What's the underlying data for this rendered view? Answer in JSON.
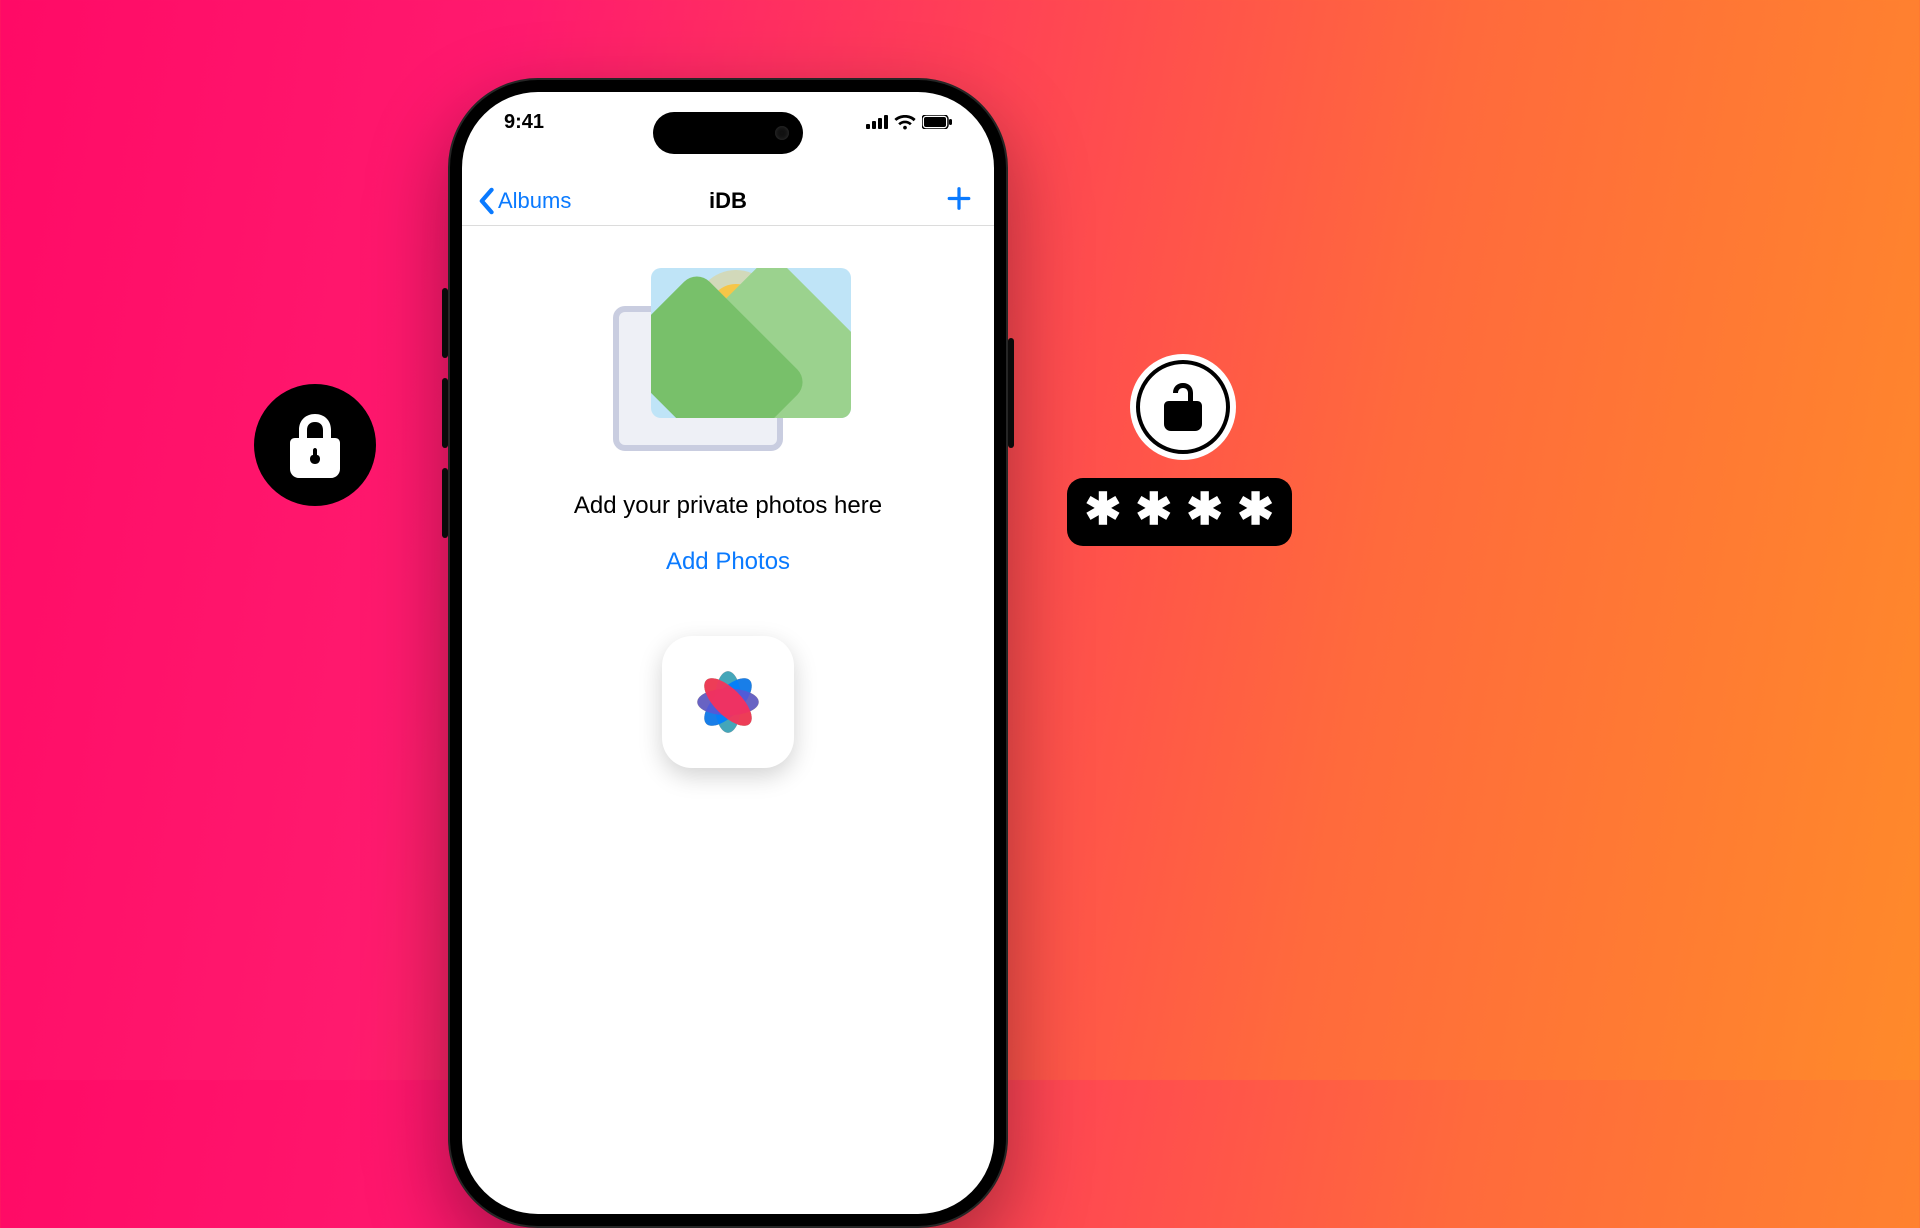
{
  "statusbar": {
    "time": "9:41"
  },
  "nav": {
    "back_label": "Albums",
    "title": "iDB"
  },
  "empty_state": {
    "heading": "Add your private photos here",
    "cta": "Add Photos"
  },
  "decor": {
    "password_mask_char": "✱"
  }
}
